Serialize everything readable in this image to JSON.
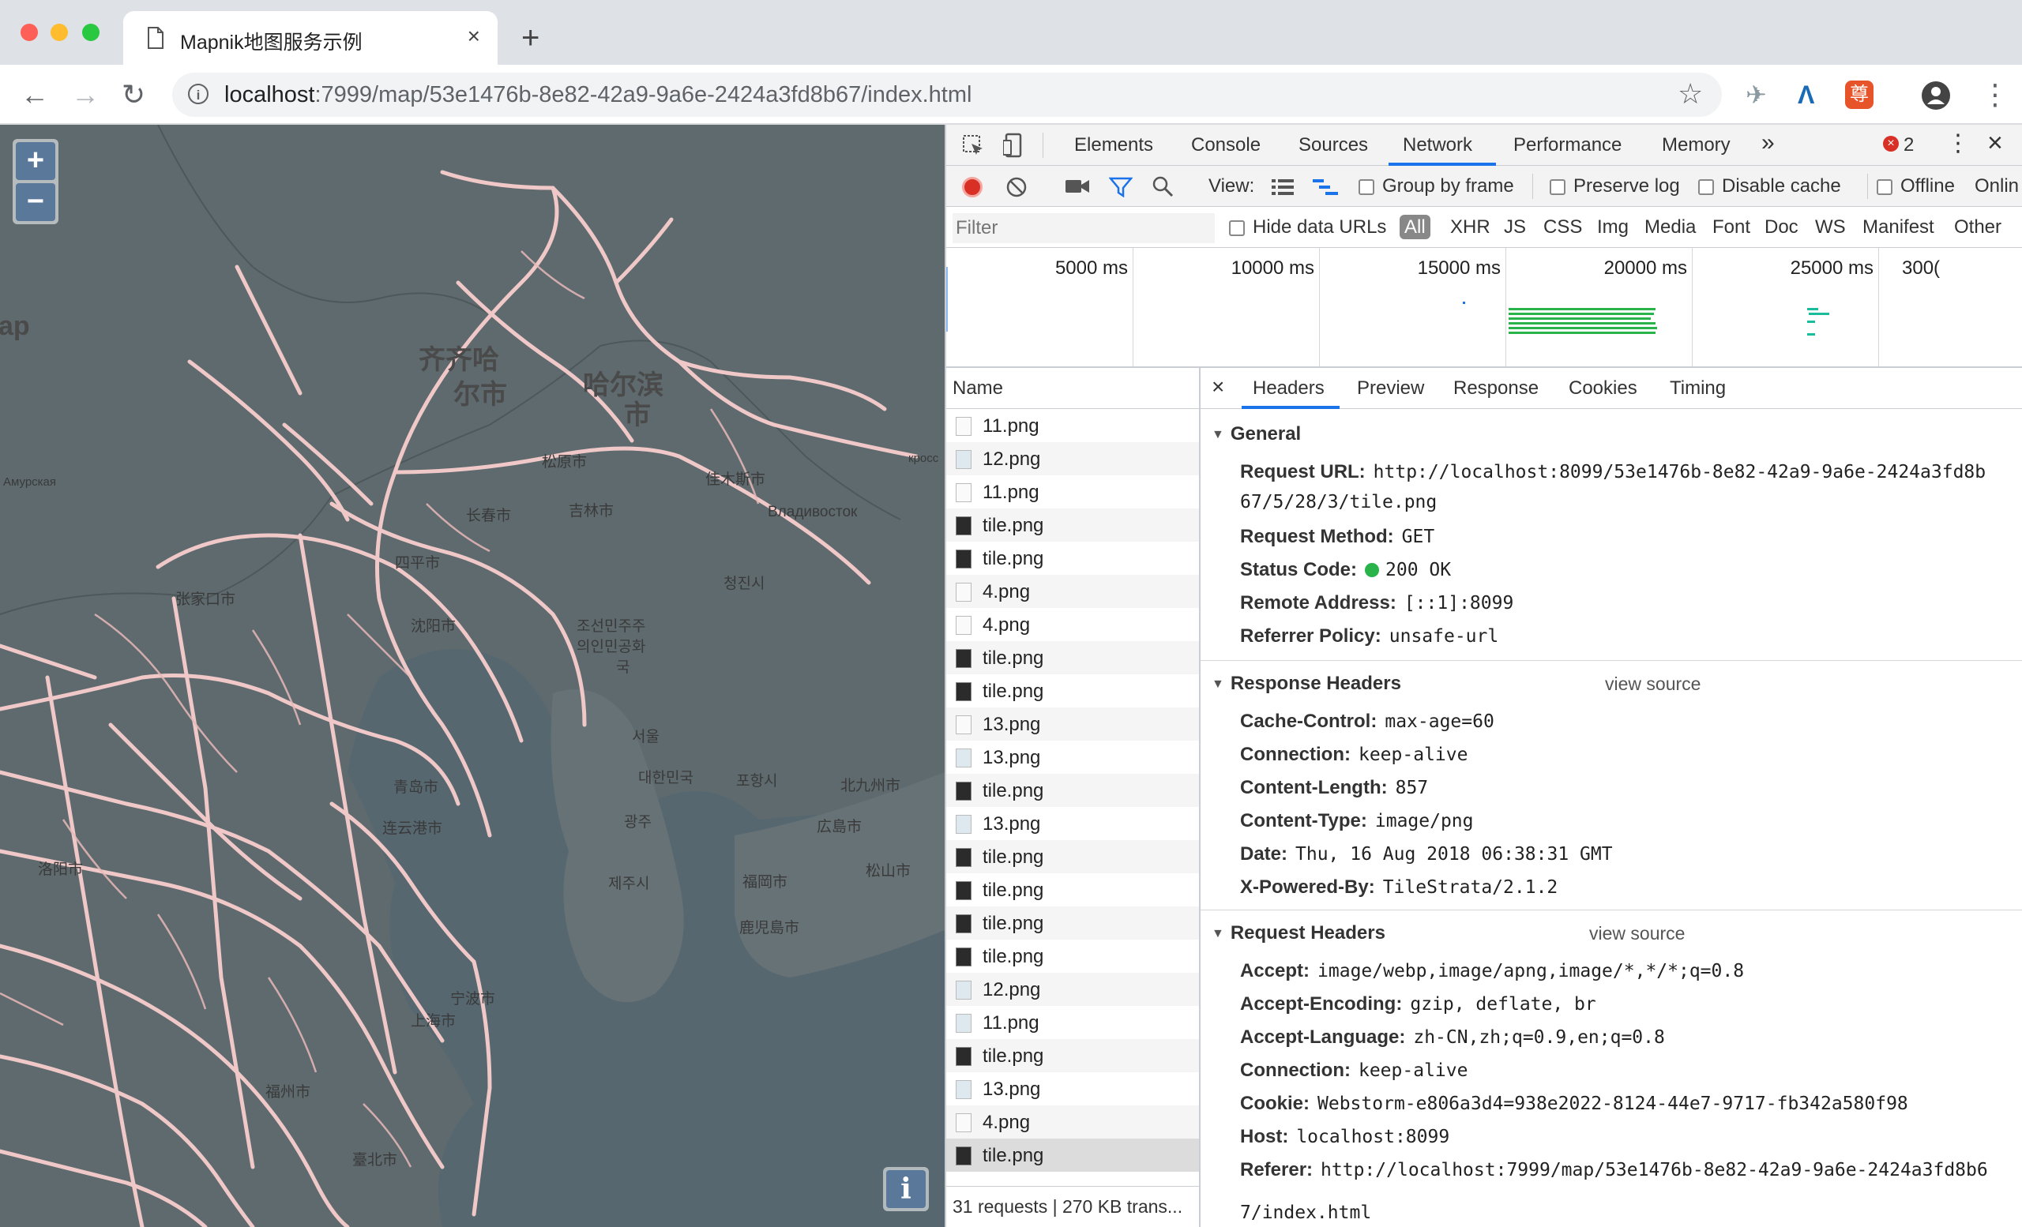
{
  "browser": {
    "tab_title": "Mapnik地图服务示例",
    "url_host": "localhost",
    "url_path": ":7999/map/53e1476b-8e82-42a9-9a6e-2424a3fd8b67/index.html",
    "extension_badge": "尊"
  },
  "map": {
    "zoom_in": "+",
    "zoom_out": "−",
    "info": "i",
    "labels": {
      "qiqihar_1": "齐齐哈",
      "qiqihar_2": "尔市",
      "harbin": "哈尔滨",
      "harbin_2": "市",
      "songyuan": "松原市",
      "jilin": "吉林市",
      "changchun": "长春市",
      "siping": "四平市",
      "shenyang": "沈阳市",
      "jiamusi": "佳木斯市",
      "vladivostok": "Владивосток",
      "qingjin": "청진시",
      "pyongyang_1": "조선민주주",
      "pyongyang_2": "의인민공화",
      "pyongyang_3": "국",
      "seoul": "서울",
      "korea": "대한민국",
      "pohang": "포항시",
      "gwangju": "광주",
      "jeju": "제주시",
      "kitakyushu": "北九州市",
      "hiroshima": "広島市",
      "matsuyama": "松山市",
      "fukuoka": "福岡市",
      "kagoshima": "鹿児島市",
      "qingdao": "青岛市",
      "lianyungang": "连云港市",
      "shanghai": "上海市",
      "ningbo": "宁波市",
      "zhangjiakou": "张家口市",
      "luoyang": "洛阳市",
      "taibei": "臺北市",
      "fuzhou": "福州市",
      "ap": "ap",
      "amur": "Амурская",
      "kross": "кросс"
    }
  },
  "devtools": {
    "tabs": [
      "Elements",
      "Console",
      "Sources",
      "Network",
      "Performance",
      "Memory"
    ],
    "more_tabs": "»",
    "error_count": "2",
    "controls": {
      "view_label": "View:",
      "group_by_frame": "Group by frame",
      "preserve_log": "Preserve log",
      "disable_cache": "Disable cache",
      "offline": "Offline",
      "online": "Onlin"
    },
    "filter": {
      "placeholder": "Filter",
      "hide_data_urls": "Hide data URLs",
      "types": [
        "All",
        "XHR",
        "JS",
        "CSS",
        "Img",
        "Media",
        "Font",
        "Doc",
        "WS",
        "Manifest",
        "Other"
      ]
    },
    "timeline_ticks": [
      "5000 ms",
      "10000 ms",
      "15000 ms",
      "20000 ms",
      "25000 ms",
      "300("
    ],
    "request_list": {
      "header": "Name",
      "rows": [
        {
          "name": "11.png",
          "icon": "blank"
        },
        {
          "name": "12.png",
          "icon": "pic"
        },
        {
          "name": "11.png",
          "icon": "blank"
        },
        {
          "name": "tile.png",
          "icon": "dark"
        },
        {
          "name": "tile.png",
          "icon": "dark"
        },
        {
          "name": "4.png",
          "icon": "blank"
        },
        {
          "name": "4.png",
          "icon": "blank"
        },
        {
          "name": "tile.png",
          "icon": "dark"
        },
        {
          "name": "tile.png",
          "icon": "dark"
        },
        {
          "name": "13.png",
          "icon": "blank"
        },
        {
          "name": "13.png",
          "icon": "pic"
        },
        {
          "name": "tile.png",
          "icon": "dark"
        },
        {
          "name": "13.png",
          "icon": "pic"
        },
        {
          "name": "tile.png",
          "icon": "dark"
        },
        {
          "name": "tile.png",
          "icon": "dark"
        },
        {
          "name": "tile.png",
          "icon": "dark"
        },
        {
          "name": "tile.png",
          "icon": "dark"
        },
        {
          "name": "12.png",
          "icon": "pic"
        },
        {
          "name": "11.png",
          "icon": "pic"
        },
        {
          "name": "tile.png",
          "icon": "dark"
        },
        {
          "name": "13.png",
          "icon": "pic"
        },
        {
          "name": "4.png",
          "icon": "blank"
        },
        {
          "name": "tile.png",
          "icon": "dark"
        }
      ],
      "summary": "31 requests | 270 KB trans..."
    },
    "detail": {
      "close": "×",
      "tabs": [
        "Headers",
        "Preview",
        "Response",
        "Cookies",
        "Timing"
      ],
      "general_title": "General",
      "general": {
        "request_url_label": "Request URL:",
        "request_url_1": "http://localhost:8099/53e1476b-8e82-42a9-9a6e-2424a3fd8b",
        "request_url_2": "67/5/28/3/tile.png",
        "request_method_label": "Request Method:",
        "request_method": "GET",
        "status_code_label": "Status Code:",
        "status_code": "200 OK",
        "remote_address_label": "Remote Address:",
        "remote_address": "[::1]:8099",
        "referrer_policy_label": "Referrer Policy:",
        "referrer_policy": "unsafe-url"
      },
      "response_headers_title": "Response Headers",
      "request_headers_title": "Request Headers",
      "view_source": "view source",
      "response_headers": [
        {
          "k": "Cache-Control:",
          "v": "max-age=60"
        },
        {
          "k": "Connection:",
          "v": "keep-alive"
        },
        {
          "k": "Content-Length:",
          "v": "857"
        },
        {
          "k": "Content-Type:",
          "v": "image/png"
        },
        {
          "k": "Date:",
          "v": "Thu, 16 Aug 2018 06:38:31 GMT"
        },
        {
          "k": "X-Powered-By:",
          "v": "TileStrata/2.1.2"
        }
      ],
      "request_headers": [
        {
          "k": "Accept:",
          "v": "image/webp,image/apng,image/*,*/*;q=0.8"
        },
        {
          "k": "Accept-Encoding:",
          "v": "gzip, deflate, br"
        },
        {
          "k": "Accept-Language:",
          "v": "zh-CN,zh;q=0.9,en;q=0.8"
        },
        {
          "k": "Connection:",
          "v": "keep-alive"
        },
        {
          "k": "Cookie:",
          "v": "Webstorm-e806a3d4=938e2022-8124-44e7-9717-fb342a580f98"
        },
        {
          "k": "Host:",
          "v": "localhost:8099"
        },
        {
          "k": "Referer:",
          "v": "http://localhost:7999/map/53e1476b-8e82-42a9-9a6e-2424a3fd8b6"
        }
      ],
      "referer_cont": "7/index.html"
    }
  }
}
